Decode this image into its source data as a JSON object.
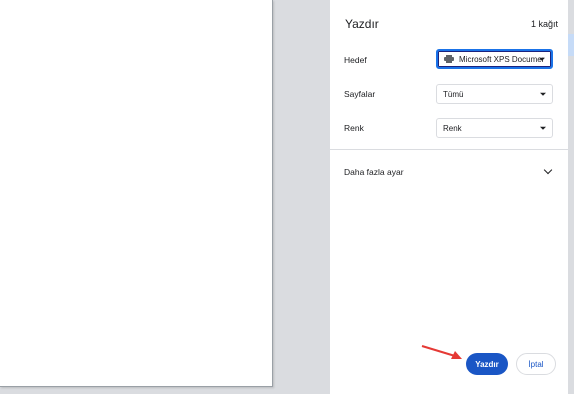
{
  "panel": {
    "title": "Yazdır",
    "sheet_count": "1 kağıt"
  },
  "settings": {
    "destination": {
      "label": "Hedef",
      "value": "Microsoft XPS Documer",
      "icon": "printer-icon"
    },
    "pages": {
      "label": "Sayfalar",
      "value": "Tümü"
    },
    "color": {
      "label": "Renk",
      "value": "Renk"
    }
  },
  "more_settings": {
    "label": "Daha fazla ayar"
  },
  "buttons": {
    "print_label": "Yazdır",
    "cancel_label": "İptal"
  },
  "colors": {
    "accent": "#1a56c5",
    "annotation_arrow": "#e53935"
  }
}
